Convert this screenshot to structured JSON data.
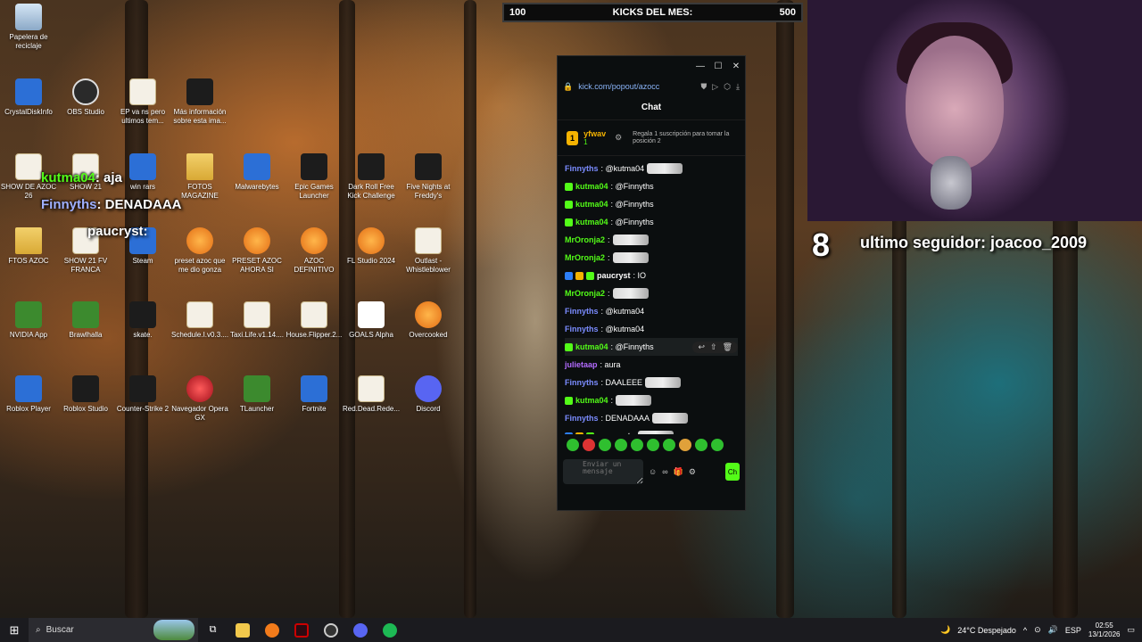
{
  "desktop": {
    "icons": [
      {
        "label": "Papelera de reciclaje",
        "icon": "recycle-bin-icon"
      },
      {
        "label": "CrystalDiskInfo",
        "icon": "crystaldiskinfo-icon"
      },
      {
        "label": "OBS Studio",
        "icon": "obs-icon"
      },
      {
        "label": "EP va ns pero ultimos tem...",
        "icon": "document-icon"
      },
      {
        "label": "Más información sobre esta ima...",
        "icon": "info-icon"
      },
      {
        "label": "SHOW DE AZOC 26",
        "icon": "document-icon"
      },
      {
        "label": "SHOW 21",
        "icon": "document-icon"
      },
      {
        "label": "win rars",
        "icon": "winrar-icon"
      },
      {
        "label": "FOTOS MAGAZINE",
        "icon": "folder-icon"
      },
      {
        "label": "Malwarebytes",
        "icon": "malwarebytes-icon"
      },
      {
        "label": "Epic Games Launcher",
        "icon": "epic-games-icon"
      },
      {
        "label": "Dark Roll Free Kick Challenge",
        "icon": "game-icon"
      },
      {
        "label": "Five Nights at Freddy's",
        "icon": "game-icon"
      },
      {
        "label": "FTOS AZOC",
        "icon": "folder-icon"
      },
      {
        "label": "SHOW 21 FV FRANCA",
        "icon": "document-icon"
      },
      {
        "label": "Steam",
        "icon": "steam-icon"
      },
      {
        "label": "preset azoc que me dio gonza",
        "icon": "fl-studio-icon"
      },
      {
        "label": "PRESET AZOC AHORA SI",
        "icon": "fl-studio-icon"
      },
      {
        "label": "AZOC DEFINITIVO",
        "icon": "fl-studio-icon"
      },
      {
        "label": "FL Studio 2024",
        "icon": "fl-studio-icon"
      },
      {
        "label": "Outlast - Whistleblower",
        "icon": "document-icon"
      },
      {
        "label": "NVIDIA App",
        "icon": "nvidia-icon"
      },
      {
        "label": "Brawlhalla",
        "icon": "brawlhalla-icon"
      },
      {
        "label": "skate.",
        "icon": "skate-icon"
      },
      {
        "label": "Schedule.I.v0.3....",
        "icon": "document-icon"
      },
      {
        "label": "Taxi.Life.v1.14....",
        "icon": "document-icon"
      },
      {
        "label": "House.Flipper.2...",
        "icon": "document-icon"
      },
      {
        "label": "GOALS Alpha",
        "icon": "goals-icon"
      },
      {
        "label": "Overcooked",
        "icon": "overcooked-icon"
      },
      {
        "label": "Roblox Player",
        "icon": "roblox-icon"
      },
      {
        "label": "Roblox Studio",
        "icon": "roblox-studio-icon"
      },
      {
        "label": "Counter-Strike 2",
        "icon": "cs2-icon"
      },
      {
        "label": "Navegador Opera GX",
        "icon": "opera-gx-icon"
      },
      {
        "label": "TLauncher",
        "icon": "tlauncher-icon"
      },
      {
        "label": "Fortnite",
        "icon": "fortnite-icon"
      },
      {
        "label": "Red.Dead.Rede...",
        "icon": "document-icon"
      },
      {
        "label": "Discord",
        "icon": "discord-icon"
      }
    ]
  },
  "overlays": {
    "kicks": {
      "left": "100",
      "title": "KICKS DEL MES:",
      "right": "500"
    },
    "chat_pop1": {
      "user": "kutma04",
      "text": ": aja"
    },
    "chat_pop2": {
      "user": "Finnyths",
      "text": ": DENADAAA"
    },
    "chat_pop3": {
      "user": "paucryst",
      "text": ":"
    },
    "count": "8",
    "last_follower": "ultimo seguidor: joacoo_2009"
  },
  "chat_window": {
    "url": "kick.com/popout/azocc",
    "title": "Chat",
    "pinned": {
      "number": "1",
      "user": "yfwav",
      "count": "1",
      "text": "Regala 1 suscripción para tomar la posición 2"
    },
    "messages": [
      {
        "user": "Finnyths",
        "text": ": @kutma04",
        "color": "#7b8cff",
        "badges": 0,
        "emote": true
      },
      {
        "user": "kutma04",
        "text": ": @Finnyths",
        "color": "#53fc18",
        "badges": 1,
        "emote": false
      },
      {
        "user": "kutma04",
        "text": ": @Finnyths",
        "color": "#53fc18",
        "badges": 1,
        "emote": false
      },
      {
        "user": "kutma04",
        "text": ": @Finnyths",
        "color": "#53fc18",
        "badges": 1,
        "emote": false
      },
      {
        "user": "MrOronja2",
        "text": ":",
        "color": "#53fc18",
        "badges": 0,
        "emote": true
      },
      {
        "user": "MrOronja2",
        "text": ":",
        "color": "#53fc18",
        "badges": 0,
        "emote": true
      },
      {
        "user": "paucryst",
        "text": ": IO",
        "color": "#ffffff",
        "badges": 3,
        "emote": false
      },
      {
        "user": "MrOronja2",
        "text": ":",
        "color": "#53fc18",
        "badges": 0,
        "emote": true
      },
      {
        "user": "Finnyths",
        "text": ": @kutma04",
        "color": "#7b8cff",
        "badges": 0,
        "emote": false
      },
      {
        "user": "Finnyths",
        "text": ": @kutma04",
        "color": "#7b8cff",
        "badges": 0,
        "emote": false
      },
      {
        "user": "kutma04",
        "text": ": @Finnyths",
        "color": "#53fc18",
        "badges": 1,
        "emote": false
      },
      {
        "user": "julietaap",
        "text": ": aura",
        "color": "#b36bff",
        "badges": 0,
        "emote": false
      },
      {
        "user": "Finnyths",
        "text": ": DAALEEE",
        "color": "#7b8cff",
        "badges": 0,
        "emote": true
      },
      {
        "user": "kutma04",
        "text": ":",
        "color": "#53fc18",
        "badges": 1,
        "emote": true
      },
      {
        "user": "Finnyths",
        "text": ": DENADAAA",
        "color": "#7b8cff",
        "badges": 0,
        "emote": true
      },
      {
        "user": "paucryst",
        "text": ":",
        "color": "#ffffff",
        "badges": 3,
        "emote": true
      }
    ],
    "input_placeholder": "Enviar un mensaje",
    "send_label": "Ch"
  },
  "taskbar": {
    "search_label": "Buscar",
    "weather": "24°C Despejado",
    "language": "ESP",
    "time": "02:55",
    "date": "13/1/2026"
  }
}
